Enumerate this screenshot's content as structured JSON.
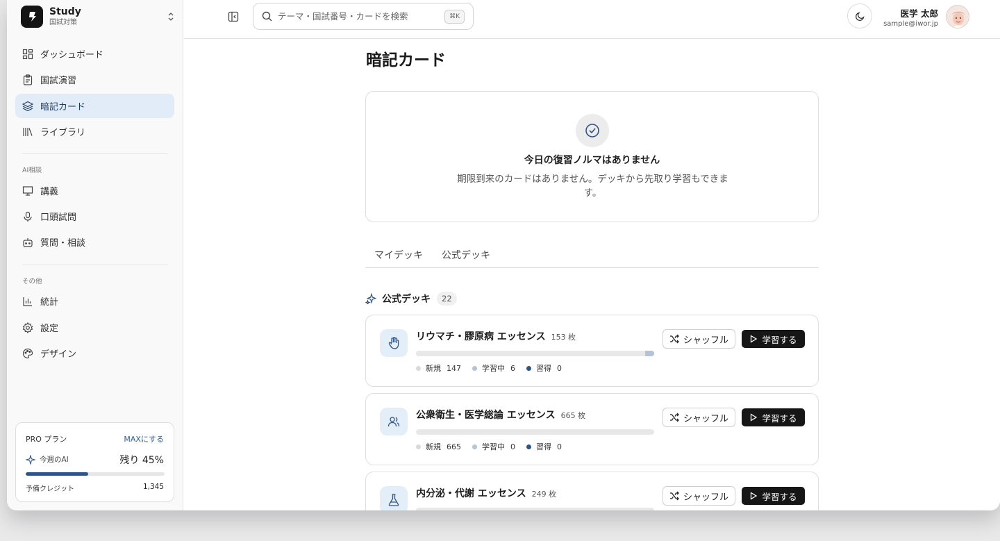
{
  "sidebar": {
    "brand": {
      "title": "Study",
      "subtitle": "国試対策"
    },
    "nav": [
      {
        "label": "ダッシュボード",
        "icon": "dashboard-icon"
      },
      {
        "label": "国試演習",
        "icon": "clipboard-icon"
      },
      {
        "label": "暗記カード",
        "icon": "layers-icon",
        "active": true
      },
      {
        "label": "ライブラリ",
        "icon": "library-icon"
      }
    ],
    "ai_section": {
      "label": "AI相談",
      "items": [
        {
          "label": "講義",
          "icon": "presentation-icon"
        },
        {
          "label": "口頭試問",
          "icon": "microphone-icon"
        },
        {
          "label": "質問・相談",
          "icon": "bot-icon"
        }
      ]
    },
    "other_section": {
      "label": "その他",
      "items": [
        {
          "label": "統計",
          "icon": "bar-chart-icon"
        },
        {
          "label": "設定",
          "icon": "gear-icon"
        },
        {
          "label": "デザイン",
          "icon": "palette-icon"
        }
      ]
    },
    "plan": {
      "name": "PRO プラン",
      "upgrade": "MAXにする",
      "ai_label": "今週のAI",
      "remaining_text": "残り 45%",
      "remaining_fraction": 0.45,
      "credit_label": "予備クレジット",
      "credit_value": "1,345"
    }
  },
  "header": {
    "search_placeholder": "テーマ・国試番号・カードを検索",
    "search_shortcut": "⌘K",
    "user_name": "医学 太郎",
    "user_email": "sample@iwor.jp"
  },
  "main": {
    "title": "暗記カード",
    "empty": {
      "title": "今日の復習ノルマはありません",
      "description": "期限到来のカードはありません。デッキから先取り学習もできます。"
    },
    "tabs": [
      "マイデッキ",
      "公式デッキ"
    ],
    "deck_heading": "公式デッキ",
    "deck_count": "22",
    "labels": {
      "new": "新規",
      "learning": "学習中",
      "mastered": "習得",
      "shuffle": "シャッフル",
      "study": "学習する",
      "unit": "枚"
    },
    "colors": {
      "accent": "#2f5587",
      "learning": "#b3c3d9",
      "active_bg": "#e2ecf8"
    },
    "decks": [
      {
        "title": "リウマチ・膠原病 エッセンス",
        "total": "153",
        "icon": "hand-icon",
        "new": 147,
        "learning": 6,
        "mastered": 0
      },
      {
        "title": "公衆衛生・医学総論 エッセンス",
        "total": "665",
        "icon": "users-icon",
        "new": 665,
        "learning": 0,
        "mastered": 0
      },
      {
        "title": "内分泌・代謝 エッセンス",
        "total": "249",
        "icon": "flask-icon",
        "new": null,
        "learning": null,
        "mastered": null
      }
    ]
  }
}
